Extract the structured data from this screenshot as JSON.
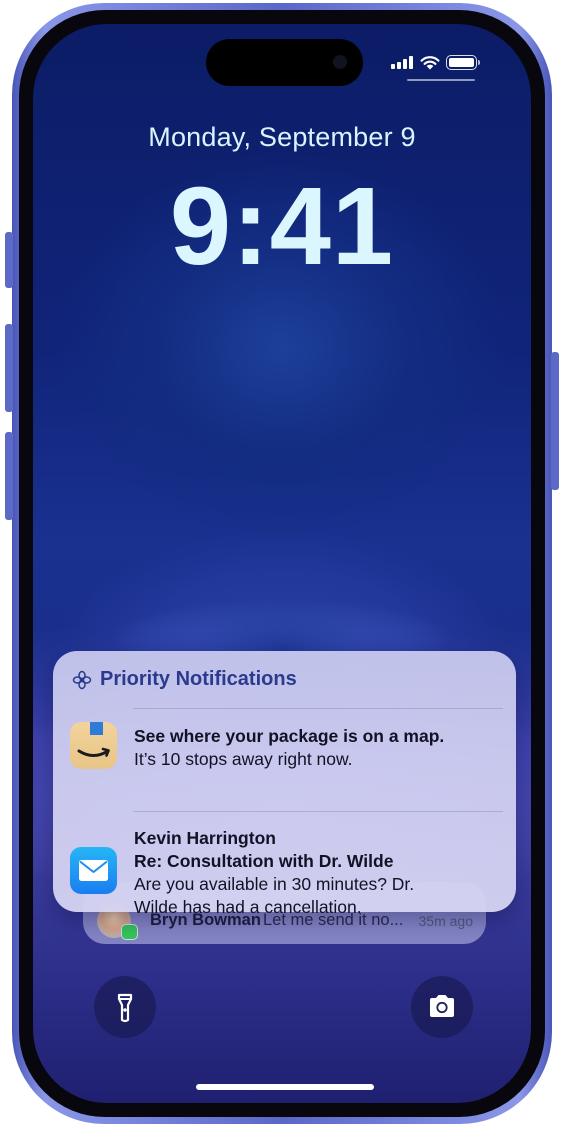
{
  "lockscreen": {
    "date": "Monday, September 9",
    "time": "9:41"
  },
  "priority_card": {
    "title": "Priority Notifications",
    "icon": "sparkle-flower-icon",
    "notifications": [
      {
        "app": "amazon-app-icon",
        "title": "See where your package is on a map.",
        "body": "It’s 10 stops away right now."
      },
      {
        "app": "mail-app-icon",
        "sender": "Kevin Harrington",
        "subject": "Re: Consultation with Dr. Wilde",
        "body_line1": "Are you available in 30 minutes? Dr.",
        "body_line2": "Wilde has had a cancellation."
      }
    ]
  },
  "stacked_notification": {
    "sender": "Bryn Bowman",
    "preview": "Let me send it no...",
    "time_ago": "35m ago",
    "icon": "messages-app-icon"
  },
  "quick_actions": {
    "left": "flashlight-icon",
    "right": "camera-icon"
  },
  "status_bar": {
    "signal": "cellular-signal-icon",
    "wifi": "wifi-icon",
    "battery": "battery-icon",
    "battery_level": 1.0
  },
  "colors": {
    "frame": "#5a67c8",
    "card_title": "#2a3a8e",
    "time_text": "#dcf6ff"
  }
}
